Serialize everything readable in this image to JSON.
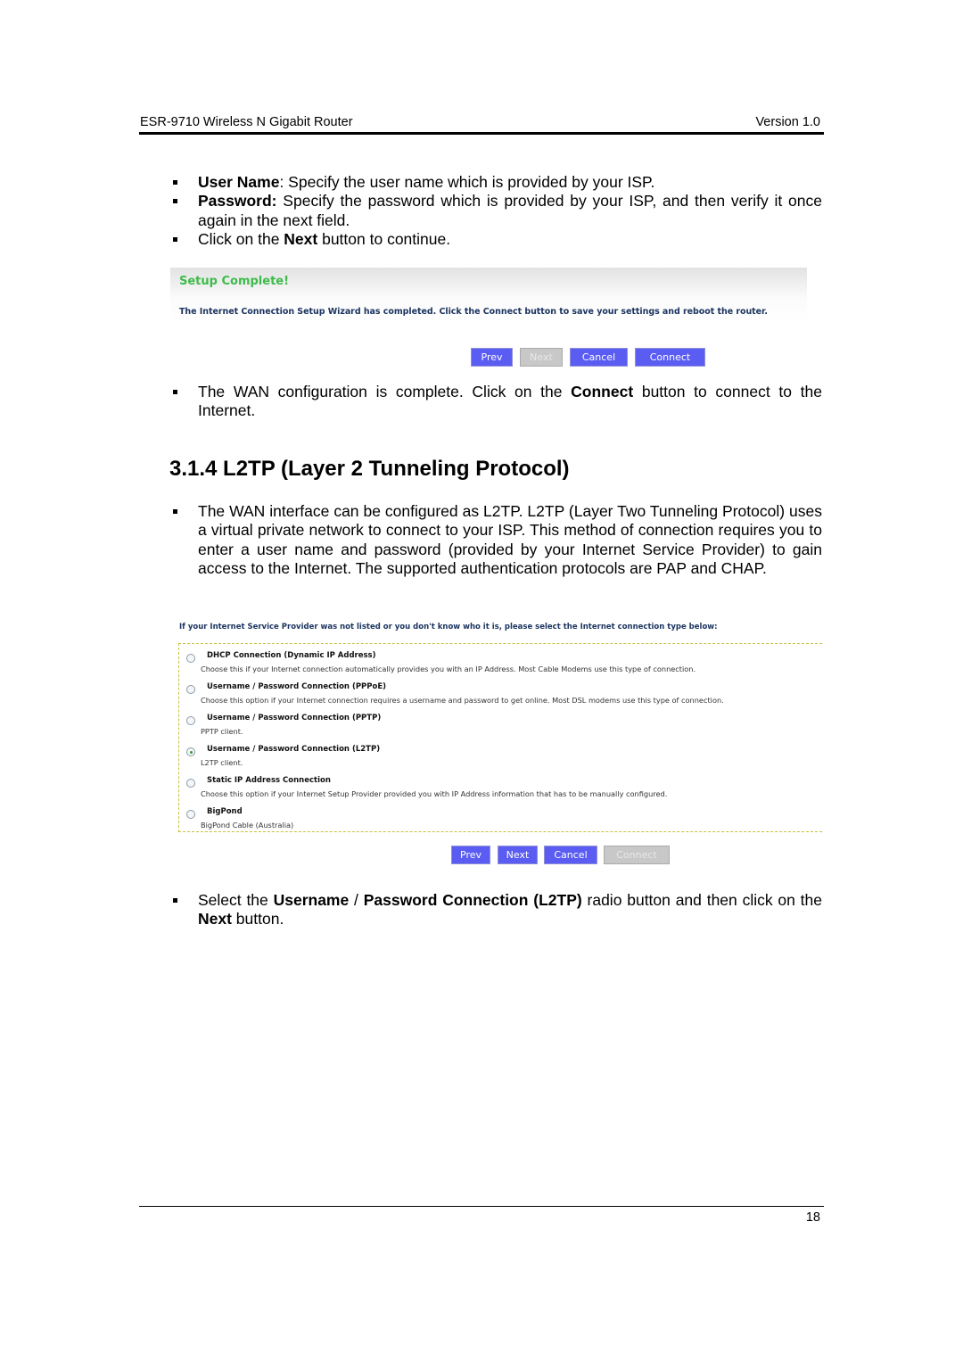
{
  "header": {
    "doc_title": "ESR-9710 Wireless N Gigabit Router",
    "version": "Version 1.0"
  },
  "footer": {
    "page_number": "18"
  },
  "intro_bullets": [
    {
      "bold": "User Name",
      "text": ": Specify the user name which is provided by your ISP."
    },
    {
      "bold": "Password:",
      "text": " Specify the password which is provided by your ISP, and then verify it once again in the next field."
    },
    {
      "pre": "Click on the ",
      "bold": "Next",
      "text": " button to continue."
    }
  ],
  "setup_complete": {
    "title": "Setup Complete!",
    "description": "The Internet Connection Setup Wizard has completed. Click the Connect button to save your settings and reboot the router.",
    "buttons": [
      {
        "label": "Prev",
        "enabled": true
      },
      {
        "label": "Next",
        "enabled": false
      },
      {
        "label": "Cancel",
        "enabled": true
      },
      {
        "label": "Connect",
        "enabled": true
      }
    ]
  },
  "wan_complete_bullet": {
    "pre": "The WAN configuration is complete. Click on the ",
    "bold": "Connect",
    "text": " button to connect to the Internet."
  },
  "section": {
    "heading": "3.1.4 L2TP (Layer 2 Tunneling Protocol)",
    "paragraph": "The WAN interface can be configured as L2TP. L2TP (Layer Two Tunneling Protocol) uses a virtual private network to connect to your ISP. This method of connection requires you to enter a user name and password (provided by your Internet Service Provider) to gain access to the Internet. The supported authentication protocols are PAP and CHAP."
  },
  "connection_type": {
    "intro": "If your Internet Service Provider was not listed or you don't know who it is, please select the Internet connection type below:",
    "options": [
      {
        "label": "DHCP Connection (Dynamic IP Address)",
        "hint": "Choose this if your Internet connection automatically provides you with an IP Address. Most Cable Modems use this type of connection.",
        "selected": false
      },
      {
        "label": "Username / Password Connection (PPPoE)",
        "hint": "Choose this option if your Internet connection requires a username and password to get online. Most DSL modems use this type of connection.",
        "selected": false
      },
      {
        "label": "Username / Password Connection (PPTP)",
        "hint": "PPTP client.",
        "selected": false
      },
      {
        "label": "Username / Password Connection (L2TP)",
        "hint": "L2TP client.",
        "selected": true
      },
      {
        "label": "Static IP Address Connection",
        "hint": "Choose this option if your Internet Setup Provider provided you with IP Address information that has to be manually configured.",
        "selected": false
      },
      {
        "label": "BigPond",
        "hint": "BigPond Cable (Australia)",
        "selected": false
      }
    ],
    "buttons": [
      {
        "label": "Prev",
        "enabled": true
      },
      {
        "label": "Next",
        "enabled": true
      },
      {
        "label": "Cancel",
        "enabled": true
      },
      {
        "label": "Connect",
        "enabled": false
      }
    ]
  },
  "final_bullet": {
    "pre": "Select the ",
    "bold1": "Username",
    "mid": " / ",
    "bold2": "Password Connection (L2TP)",
    "post": " radio button and then click on the ",
    "bold3": "Next",
    "end": " button."
  },
  "colors": {
    "button_blue": "#5a5cf2",
    "button_disabled": "#c8c8c8",
    "title_green": "#3dbb4a",
    "text_navy": "#1c3560"
  }
}
